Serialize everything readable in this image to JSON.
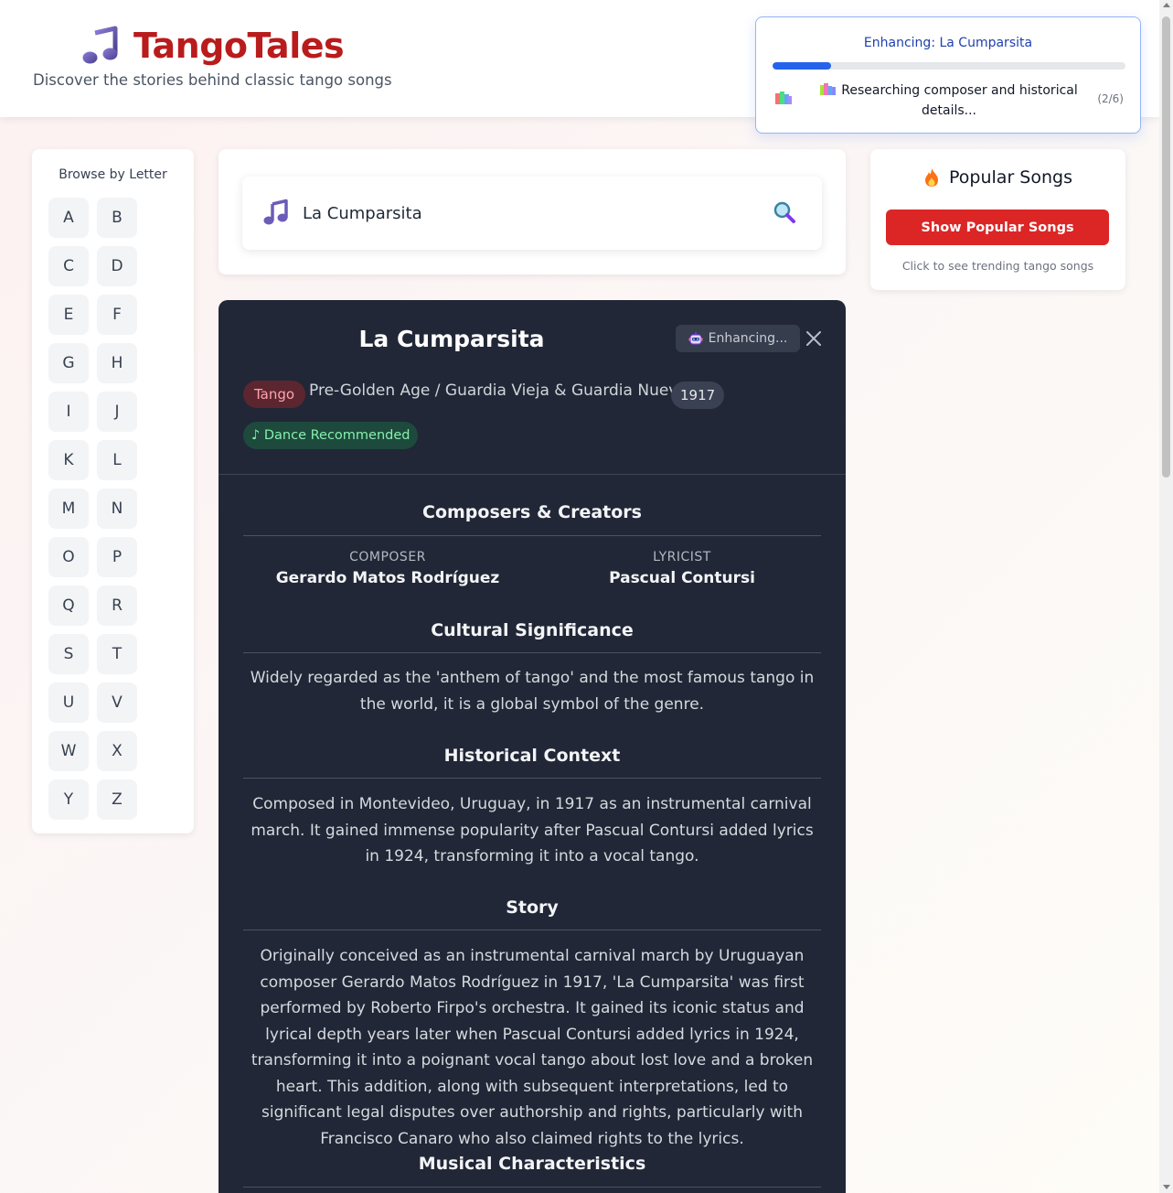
{
  "header": {
    "brand_title": "TangoTales",
    "tagline": "Discover the stories behind classic tango songs",
    "brand_icon": "music-note-icon"
  },
  "toast": {
    "title": "Enhancing: La Cumparsita",
    "progress": 0.166,
    "message": "Researching composer and historical details...",
    "step": "(2/6)",
    "icon": "books-icon",
    "accent": "#2563eb"
  },
  "letters": {
    "title": "Browse by Letter",
    "items": [
      "A",
      "B",
      "C",
      "D",
      "E",
      "F",
      "G",
      "H",
      "I",
      "J",
      "K",
      "L",
      "M",
      "N",
      "O",
      "P",
      "Q",
      "R",
      "S",
      "T",
      "U",
      "V",
      "W",
      "X",
      "Y",
      "Z"
    ]
  },
  "search": {
    "value": "La Cumparsita",
    "icon": "magnifier-icon"
  },
  "popular": {
    "title": "Popular Songs",
    "button_label": "Show Popular Songs",
    "hint": "Click to see trending tango songs",
    "icon": "fire-icon",
    "button_color": "#dc2626"
  },
  "song": {
    "title": "La Cumparsita",
    "enhancing_label": "Enhancing...",
    "genre": "Tango",
    "era": "Pre-Golden Age / Guardia Vieja & Guardia Nueva",
    "year": "1917",
    "dance_tag": "♪ Dance Recommended",
    "sections": {
      "composers_title": "Composers & Creators",
      "composer_role": "COMPOSER",
      "composer_name": "Gerardo Matos Rodríguez",
      "lyricist_role": "LYRICIST",
      "lyricist_name": "Pascual Contursi",
      "cultural_title": "Cultural Significance",
      "cultural_text": "Widely regarded as the 'anthem of tango' and the most famous tango in the world, it is a global symbol of the genre.",
      "historical_title": "Historical Context",
      "historical_text": "Composed in Montevideo, Uruguay, in 1917 as an instrumental carnival march. It gained immense popularity after Pascual Contursi added lyrics in 1924, transforming it into a vocal tango.",
      "story_title": "Story",
      "story_text": "Originally conceived as an instrumental carnival march by Uruguayan composer Gerardo Matos Rodríguez in 1917, 'La Cumparsita' was first performed by Roberto Firpo's orchestra. It gained its iconic status and lyrical depth years later when Pascual Contursi added lyrics in 1924, transforming it into a poignant vocal tango about lost love and a broken heart. This addition, along with subsequent interpretations, led to significant legal disputes over authorship and rights, particularly with Francisco Canaro who also claimed rights to the lyrics.",
      "musical_title": "Musical Characteristics"
    }
  }
}
